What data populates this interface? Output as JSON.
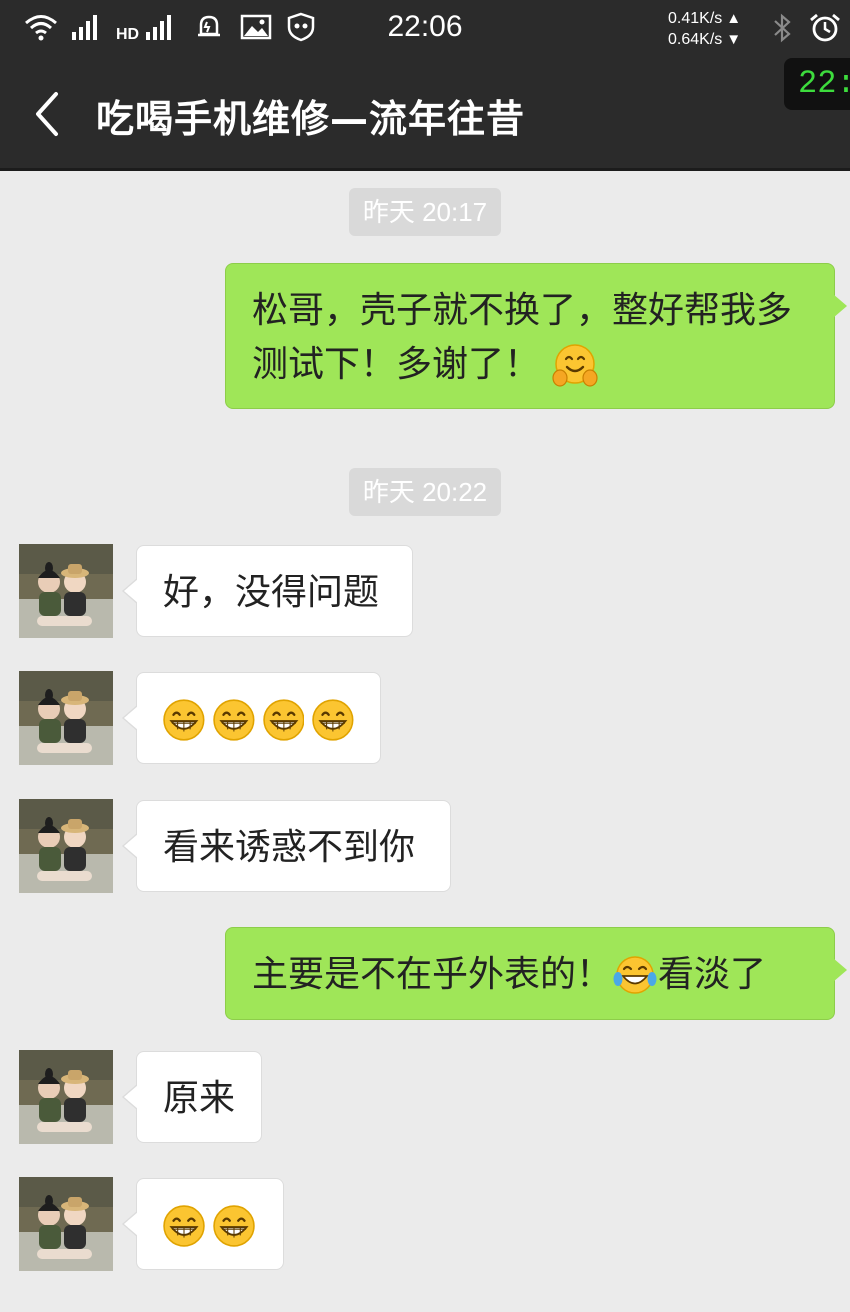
{
  "status_bar": {
    "time": "22:06",
    "speed_up": "0.41K/s",
    "speed_down": "0.64K/s",
    "icons": [
      "wifi-icon",
      "signal-icon",
      "hd-signal-icon",
      "alarm-bell-icon",
      "image-icon",
      "shield-icon",
      "bluetooth-icon",
      "alarm-clock-icon"
    ]
  },
  "header": {
    "title": "吃喝手机维修—流年往昔",
    "back_icon": "chevron-left-icon"
  },
  "clock_widget": {
    "text": "22:"
  },
  "messages": [
    {
      "type": "timestamp",
      "text": "昨天 20:17"
    },
    {
      "type": "outgoing",
      "text": "松哥，壳子就不换了，整好帮我多测试下！多谢了！",
      "emoji_after": "hug-face-emoji"
    },
    {
      "type": "timestamp",
      "text": "昨天 20:22"
    },
    {
      "type": "incoming",
      "text": "好，没得问题"
    },
    {
      "type": "incoming",
      "emojis": [
        "grin-emoji",
        "grin-emoji",
        "grin-emoji",
        "grin-emoji"
      ]
    },
    {
      "type": "incoming",
      "text": "看来诱惑不到你"
    },
    {
      "type": "outgoing",
      "text_before": "主要是不在乎外表的！",
      "emoji_mid": "tears-of-joy-emoji",
      "text_after": "看淡了"
    },
    {
      "type": "incoming",
      "text": "原来"
    },
    {
      "type": "incoming",
      "emojis": [
        "grin-emoji",
        "grin-emoji"
      ]
    }
  ],
  "colors": {
    "outgoing_bubble": "#9fe658",
    "incoming_bubble": "#ffffff",
    "chat_background": "#ebebeb",
    "header_background": "#2b2b2b"
  }
}
